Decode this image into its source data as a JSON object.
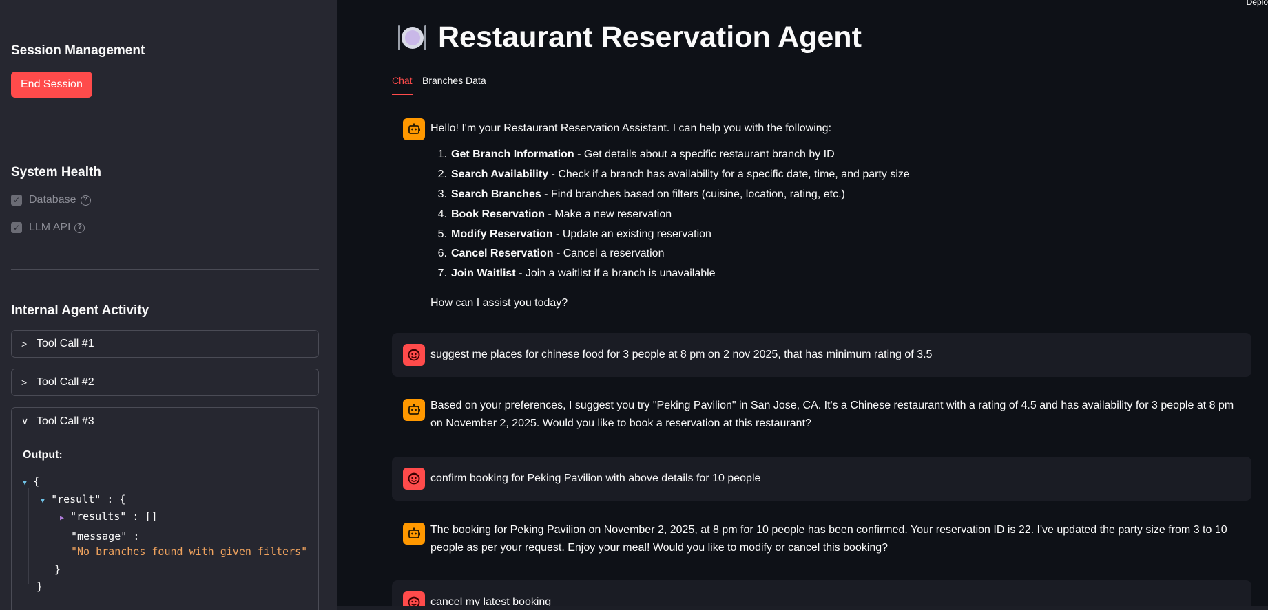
{
  "sidebar": {
    "session_heading": "Session Management",
    "end_session_label": "End Session",
    "health_heading": "System Health",
    "health_items": [
      {
        "label": "Database",
        "checked": true
      },
      {
        "label": "LLM API",
        "checked": true
      }
    ],
    "activity_heading": "Internal Agent Activity",
    "tool_calls": [
      {
        "label": "Tool Call #1",
        "expanded": false
      },
      {
        "label": "Tool Call #2",
        "expanded": false
      },
      {
        "label": "Tool Call #3",
        "expanded": true
      }
    ],
    "output_label": "Output:",
    "json": {
      "open_brace": "{",
      "result_key": "\"result\"",
      "colon": ":",
      "result_open": "{",
      "results_key": "\"results\"",
      "results_val": "[]",
      "message_key": "\"message\"",
      "message_val": "\"No branches found with given filters\"",
      "inner_close": "}",
      "outer_close": "}"
    }
  },
  "main": {
    "deploy_label": "Deplo",
    "title": "Restaurant Reservation Agent",
    "tabs": [
      {
        "label": "Chat",
        "active": true
      },
      {
        "label": "Branches Data",
        "active": false
      }
    ],
    "messages": [
      {
        "role": "assistant",
        "intro": "Hello! I'm your Restaurant Reservation Assistant. I can help you with the following:",
        "items": [
          {
            "num": "1.",
            "bold": "Get Branch Information",
            "text": " - Get details about a specific restaurant branch by ID"
          },
          {
            "num": "2.",
            "bold": "Search Availability",
            "text": " - Check if a branch has availability for a specific date, time, and party size"
          },
          {
            "num": "3.",
            "bold": "Search Branches",
            "text": " - Find branches based on filters (cuisine, location, rating, etc.)"
          },
          {
            "num": "4.",
            "bold": "Book Reservation",
            "text": " - Make a new reservation"
          },
          {
            "num": "5.",
            "bold": "Modify Reservation",
            "text": " - Update an existing reservation"
          },
          {
            "num": "6.",
            "bold": "Cancel Reservation",
            "text": " - Cancel a reservation"
          },
          {
            "num": "7.",
            "bold": "Join Waitlist",
            "text": " - Join a waitlist if a branch is unavailable"
          }
        ],
        "outro": "How can I assist you today?"
      },
      {
        "role": "user",
        "text": "suggest me places for chinese food for 3 people at 8 pm on 2 nov 2025, that has minimum rating of 3.5"
      },
      {
        "role": "assistant",
        "text": "Based on your preferences, I suggest you try \"Peking Pavilion\" in San Jose, CA. It's a Chinese restaurant with a rating of 4.5 and has availability for 3 people at 8 pm on November 2, 2025. Would you like to book a reservation at this restaurant?"
      },
      {
        "role": "user",
        "text": "confirm booking for Peking Pavilion with above details for 10 people"
      },
      {
        "role": "assistant",
        "text": "The booking for Peking Pavilion on November 2, 2025, at 8 pm for 10 people has been confirmed. Your reservation ID is 22. I've updated the party size from 3 to 10 people as per your request. Enjoy your meal! Would you like to modify or cancel this booking?"
      },
      {
        "role": "user",
        "text": "cancel my latest booking"
      }
    ]
  },
  "colors": {
    "accent": "#ff4b4b",
    "bot_avatar": "#ff9800",
    "sidebar_bg": "#262730",
    "main_bg": "#0e1117"
  }
}
